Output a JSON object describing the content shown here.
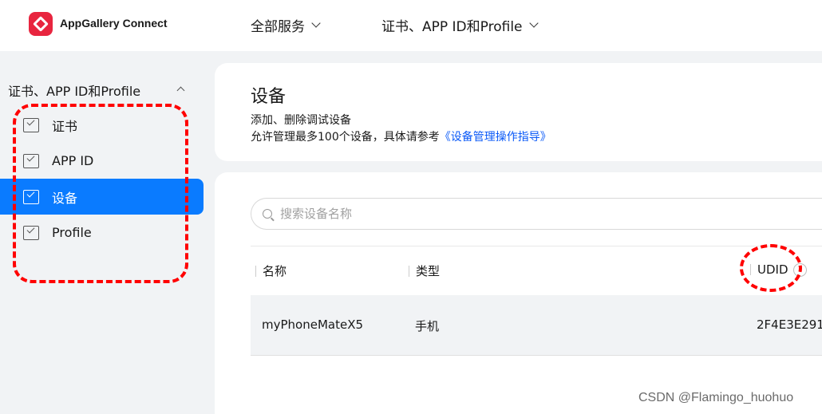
{
  "header": {
    "brand": "AppGallery Connect",
    "nav_all_services": "全部服务",
    "nav_certs": "证书、APP ID和Profile"
  },
  "sidebar": {
    "group_label": "证书、APP ID和Profile",
    "items": [
      {
        "label": "证书",
        "active": false
      },
      {
        "label": "APP ID",
        "active": false
      },
      {
        "label": "设备",
        "active": true
      },
      {
        "label": "Profile",
        "active": false
      }
    ]
  },
  "page": {
    "title": "设备",
    "desc_line1": "添加、删除调试设备",
    "desc_line2_prefix": "允许管理最多100个设备，具体请参考",
    "desc_link": "《设备管理操作指导》"
  },
  "search": {
    "placeholder": "搜索设备名称"
  },
  "table": {
    "columns": [
      "名称",
      "类型",
      "UDID"
    ],
    "help_glyph": "?",
    "rows": [
      {
        "name": "myPhoneMateX5",
        "type": "手机",
        "udid": "2F4E3E291"
      }
    ]
  },
  "watermark": "CSDN @Flamingo_huohuo",
  "colors": {
    "accent": "#0a7bff",
    "brand_red": "#e8253f",
    "annotation_red": "#ff0000",
    "link": "#0a59f7"
  }
}
